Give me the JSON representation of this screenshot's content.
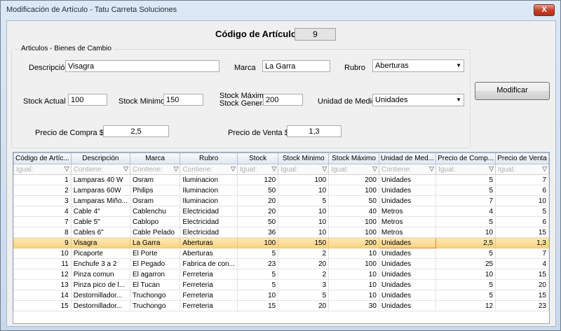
{
  "window": {
    "title": "Modificación de Artículo - Tatu Carreta Soluciones",
    "close_label": "X"
  },
  "header": {
    "codigo_label": "Código de Artículo",
    "codigo_value": "9"
  },
  "group": {
    "title": "Articulos - Bienes de Cambio"
  },
  "form": {
    "descripcion_label": "Descripción",
    "descripcion_value": "Visagra",
    "marca_label": "Marca",
    "marca_value": "La Garra",
    "rubro_label": "Rubro",
    "rubro_value": "Aberturas",
    "stock_actual_label": "Stock Actual",
    "stock_actual_value": "100",
    "stock_minimo_label": "Stock Minimo",
    "stock_minimo_value": "150",
    "stock_maximo_label_1": "Stock Máximo",
    "stock_maximo_label_2": "Stock General",
    "stock_maximo_value": "200",
    "unidad_label": "Unidad de Medida",
    "unidad_value": "Unidades",
    "precio_compra_label": "Precio de Compra  $",
    "precio_compra_value": "2,5",
    "precio_venta_label": "Precio de Venta  $",
    "precio_venta_value": "1,3"
  },
  "buttons": {
    "modificar": "Modificar"
  },
  "grid": {
    "columns": [
      "Código de Artíc...",
      "Descripción",
      "Marca",
      "Rubro",
      "Stock",
      "Stock Minimo",
      "Stock Máximo",
      "Unidad de Med...",
      "Precio de Comp...",
      "Precio de Venta"
    ],
    "filters": [
      "Igual:",
      "Contiene:",
      "Contiene:",
      "Contiene:",
      "Igual:",
      "Igual:",
      "Igual:",
      "Contiene:",
      "Igual:",
      "Igual:"
    ],
    "rows": [
      [
        "1",
        "Lamparas 40 W",
        "Osram",
        "Iluminacion",
        "120",
        "100",
        "200",
        "Unidades",
        "5",
        "7"
      ],
      [
        "2",
        "Lamparas 60W",
        "Philips",
        "Iluminacion",
        "50",
        "10",
        "100",
        "Unidades",
        "5",
        "6"
      ],
      [
        "3",
        "Lamparas Miño...",
        "Osram",
        "Iluminacion",
        "20",
        "5",
        "50",
        "Unidades",
        "7",
        "10"
      ],
      [
        "4",
        "Cable 4\"",
        "Cablenchu",
        "Electricidad",
        "20",
        "10",
        "40",
        "Metros",
        "4",
        "5"
      ],
      [
        "7",
        "Cable 5\"",
        "Cablopo",
        "Electricidad",
        "50",
        "10",
        "100",
        "Metros",
        "5",
        "6"
      ],
      [
        "8",
        "Cables 6\"",
        "Cable Pelado",
        "Electricidad",
        "36",
        "10",
        "100",
        "Metros",
        "10",
        "15"
      ],
      [
        "9",
        "Visagra",
        "La Garra",
        "Aberturas",
        "100",
        "150",
        "200",
        "Unidades",
        "2,5",
        "1,3"
      ],
      [
        "10",
        "Picaporte",
        "El Porte",
        "Aberturas",
        "5",
        "2",
        "10",
        "Unidades",
        "5",
        "7"
      ],
      [
        "11",
        "Enchufe 3 a 2",
        "El Pegado",
        "Fabrica de con...",
        "23",
        "20",
        "100",
        "Unidades",
        "25",
        "4"
      ],
      [
        "12",
        "Pinza comun",
        "El agarron",
        "Ferreteria",
        "5",
        "2",
        "10",
        "Unidades",
        "10",
        "15"
      ],
      [
        "13",
        "Pinza pico de l...",
        "El Tucan",
        "Ferreteria",
        "5",
        "3",
        "10",
        "Unidades",
        "5",
        "20"
      ],
      [
        "14",
        "Destornillador...",
        "Truchongo",
        "Ferreteria",
        "10",
        "5",
        "10",
        "Unidades",
        "5",
        "15"
      ],
      [
        "15",
        "Destornillador...",
        "Truchongo",
        "Ferreteria",
        "15",
        "20",
        "30",
        "Unidades",
        "12",
        "23"
      ]
    ],
    "selected_row_index": 6
  }
}
